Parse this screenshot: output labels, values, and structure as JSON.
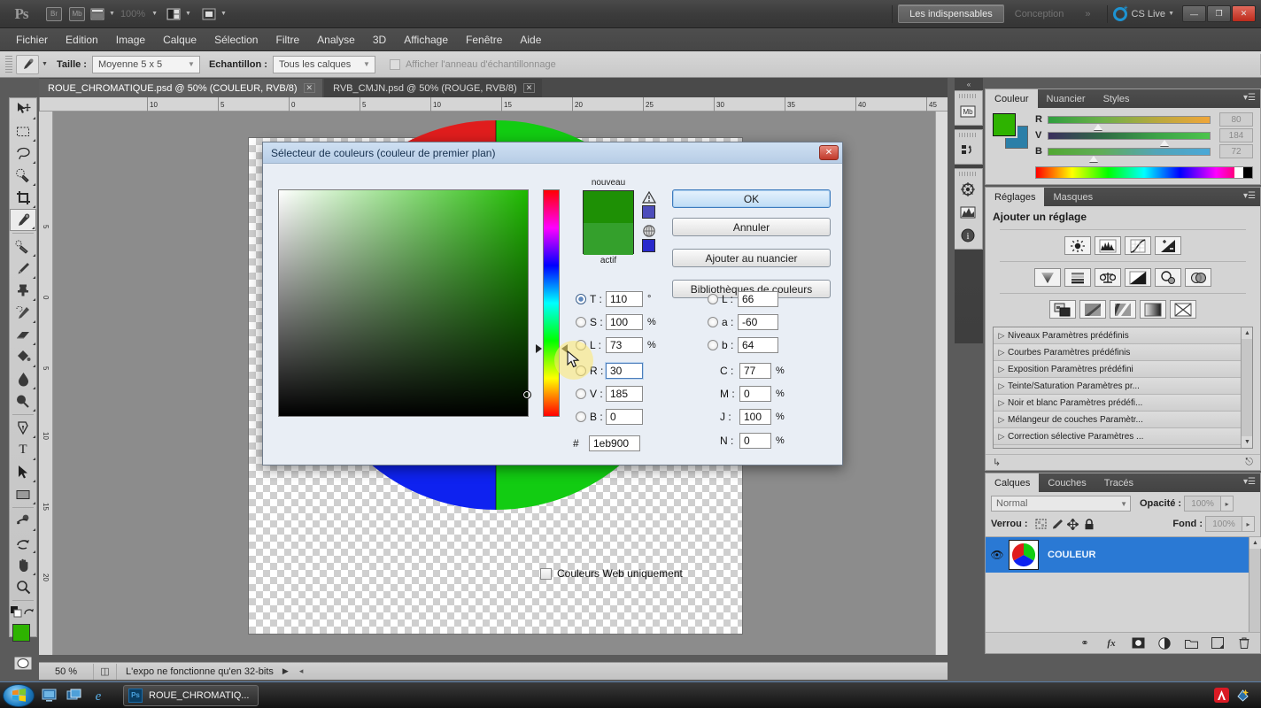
{
  "app": {
    "logo": "Ps",
    "zoom_level": "100%"
  },
  "titlebar": {
    "bridge_icon": "Br",
    "minibridge_icon": "Mb",
    "extras_icon": "view-extras-icon",
    "arrange_icon": "arrange-documents-icon",
    "screenmode_icon": "screen-mode-icon",
    "workspaces": [
      {
        "label": "Les indispensables",
        "active": true
      },
      {
        "label": "Conception",
        "active": false
      }
    ],
    "more_workspaces": "»",
    "cs_live": "CS Live",
    "window_buttons": {
      "minimize": "—",
      "restore": "❐",
      "close": "✕"
    }
  },
  "menubar": {
    "items": [
      "Fichier",
      "Edition",
      "Image",
      "Calque",
      "Sélection",
      "Filtre",
      "Analyse",
      "3D",
      "Affichage",
      "Fenêtre",
      "Aide"
    ]
  },
  "optionsbar": {
    "tool_icon": "eyedropper-icon",
    "size_label": "Taille :",
    "size_value": "Moyenne 5 x 5",
    "sample_label": "Echantillon :",
    "sample_value": "Tous les calques",
    "ring_checkbox_label": "Afficher l'anneau d'échantillonnage",
    "ring_checked": false
  },
  "tabs": [
    {
      "label": "ROUE_CHROMATIQUE.psd @ 50% (COULEUR, RVB/8)",
      "active": true,
      "close": "✕"
    },
    {
      "label": "RVB_CMJN.psd @ 50% (ROUGE, RVB/8)",
      "active": false,
      "close": "✕"
    }
  ],
  "toolbar": {
    "tools": [
      {
        "name": "move-tool",
        "glyph": "➤",
        "selected": false,
        "sub": true
      },
      {
        "name": "rectangular-marquee-tool",
        "glyph": "⬚",
        "selected": false,
        "sub": true
      },
      {
        "name": "lasso-tool",
        "glyph": "○",
        "selected": false,
        "sub": true
      },
      {
        "name": "quick-selection-tool",
        "glyph": "✦",
        "selected": false,
        "sub": true
      },
      {
        "name": "crop-tool",
        "glyph": "⌗",
        "selected": false,
        "sub": true
      },
      {
        "name": "eyedropper-tool",
        "glyph": "✒",
        "selected": true,
        "sub": true
      },
      {
        "name": "spot-healing-brush-tool",
        "glyph": "✐",
        "selected": false,
        "sub": true
      },
      {
        "name": "brush-tool",
        "glyph": "✏",
        "selected": false,
        "sub": true
      },
      {
        "name": "clone-stamp-tool",
        "glyph": "⚑",
        "selected": false,
        "sub": true
      },
      {
        "name": "history-brush-tool",
        "glyph": "✄",
        "selected": false,
        "sub": true
      },
      {
        "name": "eraser-tool",
        "glyph": "▱",
        "selected": false,
        "sub": true
      },
      {
        "name": "gradient-tool",
        "glyph": "◩",
        "selected": false,
        "sub": true
      },
      {
        "name": "blur-tool",
        "glyph": "●",
        "selected": false,
        "sub": true
      },
      {
        "name": "dodge-tool",
        "glyph": "◔",
        "selected": false,
        "sub": true
      },
      {
        "name": "pen-tool",
        "glyph": "✑",
        "selected": false,
        "sub": true
      },
      {
        "name": "type-tool",
        "glyph": "T",
        "selected": false,
        "sub": true
      },
      {
        "name": "path-selection-tool",
        "glyph": "⮝",
        "selected": false,
        "sub": true
      },
      {
        "name": "rectangle-shape-tool",
        "glyph": "▭",
        "selected": false,
        "sub": true
      },
      {
        "name": "3d-object-rotate-tool",
        "glyph": "◑",
        "selected": false,
        "sub": true
      },
      {
        "name": "3d-camera-rotate-tool",
        "glyph": "↺",
        "selected": false,
        "sub": true
      },
      {
        "name": "hand-tool",
        "glyph": "✋",
        "selected": false,
        "sub": true
      },
      {
        "name": "zoom-tool",
        "glyph": "⚲",
        "selected": false,
        "sub": false
      }
    ],
    "default_colors_icon": "default-colors-icon",
    "swap_colors_icon": "swap-colors-icon",
    "foreground_color": "#2eb300",
    "background_color": "#2b7fa8",
    "quickmask_icon": "quick-mask-icon"
  },
  "ruler": {
    "unit_ticks": [
      "10",
      "5",
      "0",
      "5",
      "10",
      "15",
      "20",
      "25",
      "30",
      "35",
      "40",
      "45"
    ]
  },
  "canvas": {
    "wheel_colors": {
      "green": "#12cc12",
      "blue": "#0e22f0",
      "red": "#e01d1d"
    },
    "checker_light": "#ffffff",
    "checker_dark": "#cfcfcf"
  },
  "statusbar": {
    "zoom": "50 %",
    "doc_icon": "document-info-icon",
    "message": "L'expo ne fonctionne qu'en 32-bits",
    "arrow": "▶"
  },
  "rail": {
    "collapse": "«",
    "icons": [
      {
        "name": "mini-bridge-icon",
        "glyph": "Mb"
      },
      {
        "name": "history-icon",
        "glyph": "↶"
      },
      {
        "name": "3d-icon",
        "glyph": "☸"
      },
      {
        "name": "histogram-icon",
        "glyph": "◥"
      },
      {
        "name": "info-icon",
        "glyph": "i"
      }
    ]
  },
  "color_panel": {
    "tabs": [
      {
        "label": "Couleur",
        "active": true
      },
      {
        "label": "Nuancier",
        "active": false
      },
      {
        "label": "Styles",
        "active": false
      }
    ],
    "menu_icon": "panel-menu-icon",
    "foreground": "#2eb300",
    "background": "#2b7fa8",
    "channels": [
      {
        "label": "R",
        "value": "80",
        "knob_pct": 31,
        "gradient": "linear-gradient(90deg,#2f9e3f,#6cb04a,#b8a93f,#f0a63a)"
      },
      {
        "label": "V",
        "value": "184",
        "knob_pct": 72,
        "gradient": "linear-gradient(90deg,#3b2f5e,#2f6a46,#3ca348,#4cc44c)"
      },
      {
        "label": "B",
        "value": "72",
        "knob_pct": 28,
        "gradient": "linear-gradient(90deg,#52a832,#61ad58,#53a5b8,#4aa8d8)"
      }
    ]
  },
  "adjustments_panel": {
    "tabs": [
      {
        "label": "Réglages",
        "active": true
      },
      {
        "label": "Masques",
        "active": false
      }
    ],
    "title": "Ajouter un réglage",
    "icons_row1": [
      {
        "name": "brightness-contrast-icon",
        "glyph": "☀"
      },
      {
        "name": "levels-icon",
        "glyph": "ᴻ"
      },
      {
        "name": "curves-icon",
        "glyph": "↗"
      },
      {
        "name": "exposure-icon",
        "glyph": "◢"
      }
    ],
    "icons_row2": [
      {
        "name": "vibrance-icon",
        "glyph": "▽"
      },
      {
        "name": "hue-saturation-icon",
        "glyph": "≡"
      },
      {
        "name": "color-balance-icon",
        "glyph": "⚖"
      },
      {
        "name": "black-white-icon",
        "glyph": "◨"
      },
      {
        "name": "photo-filter-icon",
        "glyph": "⚲"
      },
      {
        "name": "channel-mixer-icon",
        "glyph": "◕"
      }
    ],
    "icons_row3": [
      {
        "name": "invert-icon",
        "glyph": "◰"
      },
      {
        "name": "posterize-icon",
        "glyph": "◧"
      },
      {
        "name": "threshold-icon",
        "glyph": "◨"
      },
      {
        "name": "gradient-map-icon",
        "glyph": "▦"
      },
      {
        "name": "selective-color-icon",
        "glyph": "✕"
      }
    ],
    "presets": [
      "Niveaux Paramètres prédéfinis",
      "Courbes Paramètres prédéfinis",
      "Exposition Paramètres prédéfini",
      "Teinte/Saturation Paramètres pr...",
      "Noir et blanc Paramètres prédéfi...",
      "Mélangeur de couches Paramètr...",
      "Correction sélective Paramètres ..."
    ],
    "footer_icons": [
      {
        "name": "clip-to-layer-icon",
        "glyph": "↳"
      },
      {
        "name": "delete-adjustment-icon",
        "glyph": "🗑"
      }
    ]
  },
  "layers_panel": {
    "tabs": [
      {
        "label": "Calques",
        "active": true
      },
      {
        "label": "Couches",
        "active": false
      },
      {
        "label": "Tracés",
        "active": false
      }
    ],
    "blend_mode": "Normal",
    "opacity_label": "Opacité :",
    "opacity_value": "100%",
    "lock_label": "Verrou :",
    "lock_icons": [
      {
        "name": "lock-transparent-pixels-icon",
        "glyph": "▨"
      },
      {
        "name": "lock-image-pixels-icon",
        "glyph": "✎"
      },
      {
        "name": "lock-position-icon",
        "glyph": "✚"
      },
      {
        "name": "lock-all-icon",
        "glyph": "🔒"
      }
    ],
    "fill_label": "Fond :",
    "fill_value": "100%",
    "layers": [
      {
        "name": "COULEUR",
        "visible": true,
        "selected": true
      }
    ],
    "footer_icons": [
      {
        "name": "link-layers-icon",
        "glyph": "⚭"
      },
      {
        "name": "layer-style-icon",
        "glyph": "fx"
      },
      {
        "name": "layer-mask-icon",
        "glyph": "●"
      },
      {
        "name": "new-fill-adjustment-icon",
        "glyph": "◑"
      },
      {
        "name": "new-group-icon",
        "glyph": "▭"
      },
      {
        "name": "new-layer-icon",
        "glyph": "◳"
      },
      {
        "name": "delete-layer-icon",
        "glyph": "🗑"
      }
    ]
  },
  "color_picker": {
    "title": "Sélecteur de couleurs (couleur de premier plan)",
    "close": "✕",
    "new_label": "nouveau",
    "current_label": "actif",
    "new_color": "#1e9005",
    "current_color": "#34a02c",
    "gamut_warning_icon": "out-of-gamut-warning-icon",
    "gamut_swatch": "#4d4dbb",
    "web_safe_icon": "non-web-safe-icon",
    "web_swatch": "#2929cc",
    "buttons": [
      {
        "label": "OK",
        "primary": true
      },
      {
        "label": "Annuler",
        "primary": false
      },
      {
        "label": "Ajouter au nuancier",
        "primary": false
      },
      {
        "label": "Bibliothèques de couleurs",
        "primary": false
      }
    ],
    "hsb": [
      {
        "label": "T :",
        "value": "110",
        "unit": "°",
        "selected": true
      },
      {
        "label": "S :",
        "value": "100",
        "unit": "%",
        "selected": false
      },
      {
        "label": "L :",
        "value": "73",
        "unit": "%",
        "selected": false
      }
    ],
    "rgb": [
      {
        "label": "R :",
        "value": "30",
        "unit": "",
        "selected": false,
        "focused": true
      },
      {
        "label": "V :",
        "value": "185",
        "unit": "",
        "selected": false,
        "focused": false
      },
      {
        "label": "B :",
        "value": "0",
        "unit": "",
        "selected": false,
        "focused": false
      }
    ],
    "lab": [
      {
        "label": "L :",
        "value": "66",
        "unit": "",
        "selected": false
      },
      {
        "label": "a :",
        "value": "-60",
        "unit": "",
        "selected": false
      },
      {
        "label": "b :",
        "value": "64",
        "unit": "",
        "selected": false
      }
    ],
    "cmyk": [
      {
        "label": "C :",
        "value": "77",
        "unit": "%"
      },
      {
        "label": "M :",
        "value": "0",
        "unit": "%"
      },
      {
        "label": "J :",
        "value": "100",
        "unit": "%"
      },
      {
        "label": "N :",
        "value": "0",
        "unit": "%"
      }
    ],
    "hex_label": "#",
    "hex_value": "1eb900",
    "web_only_label": "Couleurs Web uniquement",
    "web_only_checked": false
  },
  "taskbar": {
    "start_icon": "windows-start-icon",
    "quicklaunch": [
      {
        "name": "show-desktop-icon",
        "glyph": "▣"
      },
      {
        "name": "switch-windows-icon",
        "glyph": "❐"
      },
      {
        "name": "internet-explorer-icon",
        "glyph": "e"
      }
    ],
    "task_label": "ROUE_CHROMATIQ...",
    "task_icon": "Ps",
    "tray": [
      {
        "name": "avira-icon",
        "glyph": "A"
      },
      {
        "name": "system-tray-icon",
        "glyph": "⚙"
      }
    ]
  }
}
